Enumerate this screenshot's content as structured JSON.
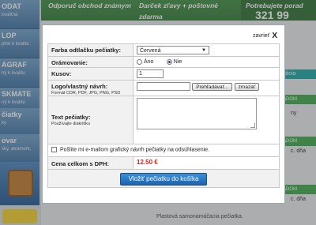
{
  "background": {
    "sidebar": [
      {
        "title": "ODAT",
        "sub": "kvalitná"
      },
      {
        "title": "LOP",
        "sub": "plné k kvalitu"
      },
      {
        "title": "AGRAF",
        "sub": "ný k kvalitu"
      },
      {
        "title": "SKMATE",
        "sub": "ný k kvalitu"
      },
      {
        "title": "čiatky",
        "sub": "ky"
      },
      {
        "title": "ovar",
        "sub": "sky, atrament,"
      }
    ],
    "banners": [
      {
        "text": "Odporuč obchod známym"
      },
      {
        "text": "Darček zľavy + poštovné",
        "sub": "zdarma"
      },
      {
        "text": "Potrebujete porad",
        "sub": "321 99"
      }
    ],
    "teal_bar": "edicia",
    "green_badges": [
      "ADOM",
      "ADOM",
      "ADOM"
    ],
    "side_texts": [
      "ny",
      "c. dňa",
      "c. dňa"
    ],
    "footer_text": "Plastová samonamáčacia pečiatka."
  },
  "modal": {
    "close_label": "zavrieť",
    "close_symbol": "X",
    "color": {
      "label": "Farba odtlačku pečiatky:",
      "value": "Červená"
    },
    "frame": {
      "label": "Orámovanie:",
      "options": [
        {
          "label": "Áno",
          "checked": false
        },
        {
          "label": "Nie",
          "checked": true
        }
      ]
    },
    "quantity": {
      "label": "Kusov:",
      "value": "1"
    },
    "logo": {
      "label": "Logo/vlastný návrh:",
      "formats": "Formát CDR, PDF, JPG, PNG, PSD",
      "browse_label": "Prehľadávať...",
      "delete_label": "zmazať"
    },
    "text": {
      "label": "Text pečiatky:",
      "hint": "Používajte diakritiku",
      "value": ""
    },
    "email_opt": {
      "label": "Pošlite mi e-mailom grafický návrh pečiatky na odsúhlasenie.",
      "checked": false
    },
    "total": {
      "label": "Cena celkom s DPH:",
      "value": "12.50 €"
    },
    "submit_label": "Vložiť pečiatku do košíka"
  },
  "colors": {
    "price": "#e8231c",
    "submit_bg": "#1c62b0",
    "overlay": "rgba(70,70,70,0.38)"
  }
}
